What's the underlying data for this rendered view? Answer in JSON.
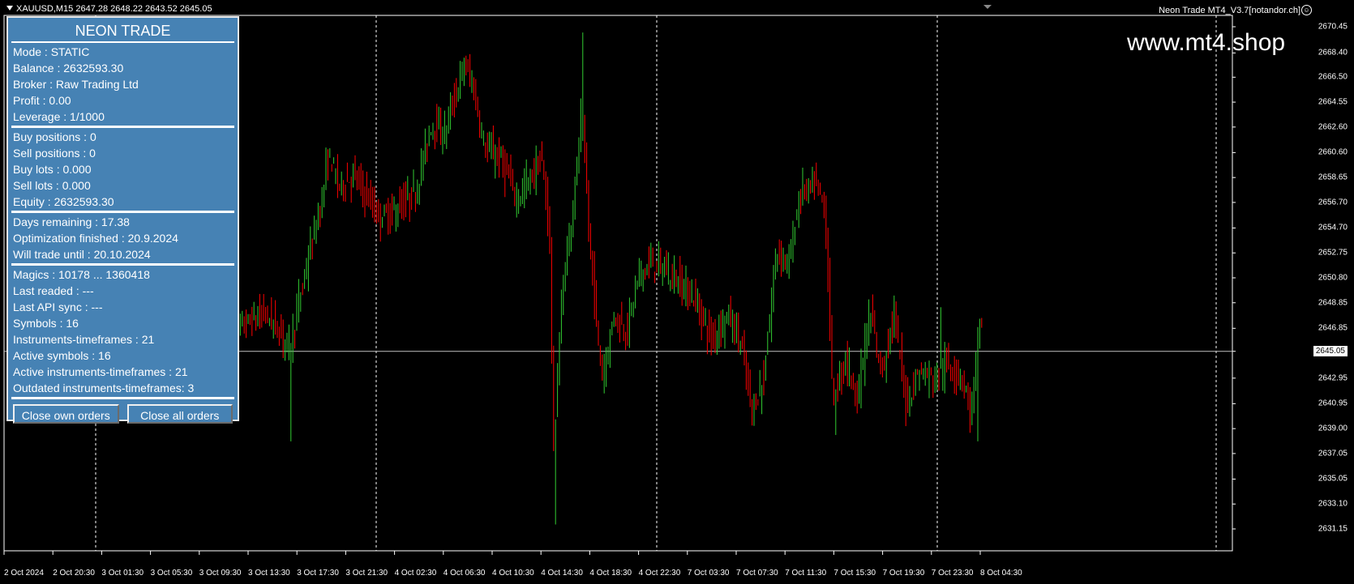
{
  "header": {
    "symbol_info": "XAUUSD,M15  2647.28 2648.22 2643.52 2645.05",
    "ea_name": "Neon Trade MT4_V3.7[notandor.ch]",
    "watermark": "www.mt4.shop"
  },
  "panel": {
    "title": "NEON TRADE",
    "account": [
      "Mode : STATIC",
      "Balance : 2632593.30",
      "Broker : Raw Trading Ltd",
      "Profit : 0.00",
      "Leverage : 1/1000"
    ],
    "positions": [
      "Buy positions : 0",
      "Sell positions : 0",
      "Buy lots : 0.000",
      "Sell lots : 0.000",
      "Equity : 2632593.30"
    ],
    "license": [
      "Days remaining : 17.38",
      "Optimization finished : 20.9.2024",
      "Will trade until : 20.10.2024"
    ],
    "stats": [
      "Magics : 10178 ... 1360418",
      "Last readed :  ---",
      "Last API sync :  ---",
      "Symbols : 16",
      "Instruments-timeframes : 21",
      "Active symbols : 16",
      "Active instruments-timeframes : 21",
      "Outdated instruments-timeframes: 3"
    ],
    "buttons": {
      "close_own": "Close own orders",
      "close_all": "Close all orders"
    }
  },
  "price_axis": [
    "2670.45",
    "2668.40",
    "2666.50",
    "2664.55",
    "2662.60",
    "2660.60",
    "2658.65",
    "2656.70",
    "2654.70",
    "2652.75",
    "2650.80",
    "2648.85",
    "2646.85",
    "2645.05",
    "2642.95",
    "2640.95",
    "2639.00",
    "2637.05",
    "2635.05",
    "2633.10",
    "2631.15"
  ],
  "current_price": "2645.05",
  "time_axis": [
    "2 Oct 2024",
    "2 Oct 20:30",
    "3 Oct 01:30",
    "3 Oct 05:30",
    "3 Oct 09:30",
    "3 Oct 13:30",
    "3 Oct 17:30",
    "3 Oct 21:30",
    "4 Oct 02:30",
    "4 Oct 06:30",
    "4 Oct 10:30",
    "4 Oct 14:30",
    "4 Oct 18:30",
    "4 Oct 22:30",
    "7 Oct 03:30",
    "7 Oct 07:30",
    "7 Oct 11:30",
    "7 Oct 15:30",
    "7 Oct 19:30",
    "7 Oct 23:30",
    "8 Oct 04:30"
  ],
  "colors": {
    "background": "#000000",
    "bull": "#32cd32",
    "bear": "#ff0000",
    "panel": "#4682b4",
    "grid": "#ffffff"
  }
}
